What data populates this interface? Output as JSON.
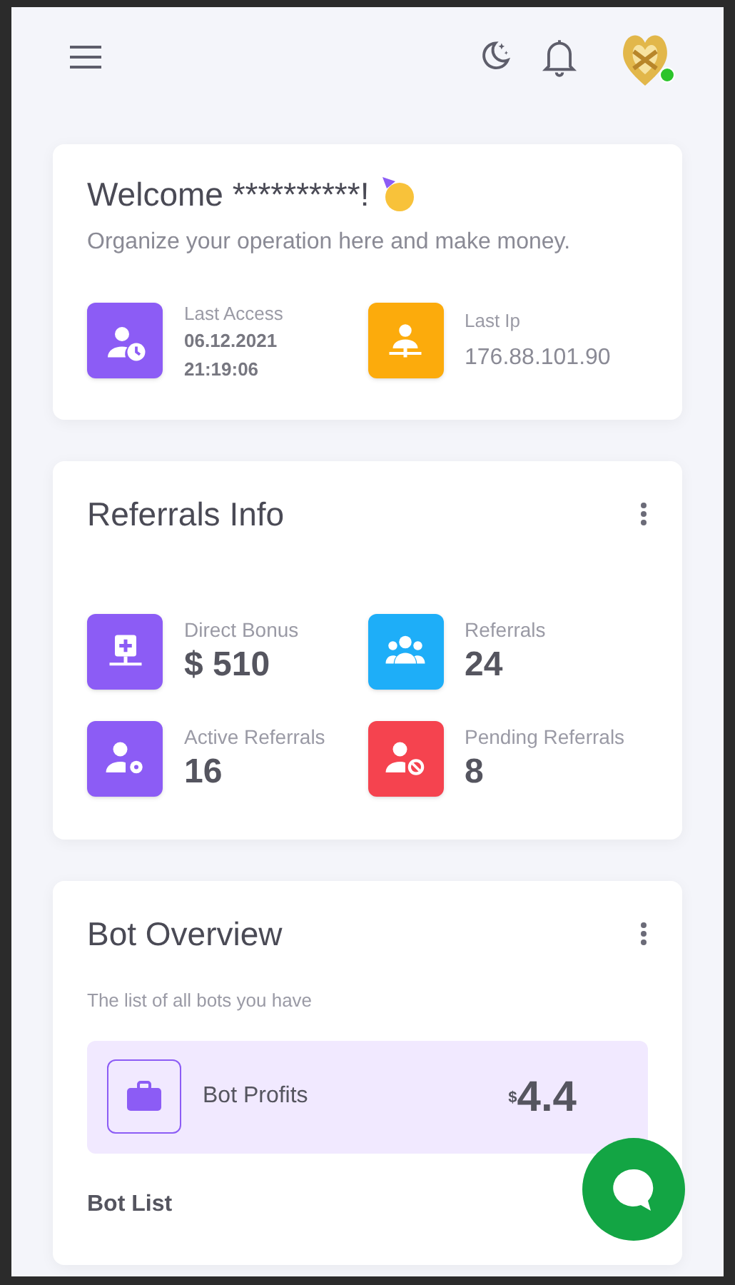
{
  "welcome": {
    "title": "Welcome **********!",
    "subtitle": "Organize your operation here and make money.",
    "stats": [
      {
        "kind": "access",
        "label": "Last Access",
        "lines": [
          "06.12.2021",
          "21:19:06"
        ],
        "color": "#8c5cf5"
      },
      {
        "kind": "ip",
        "label": "Last Ip",
        "lines": [
          "176.88.101.90"
        ],
        "color": "#fcab0c"
      }
    ]
  },
  "referrals": {
    "title": "Referrals Info",
    "stats": [
      {
        "kind": "bonus",
        "label": "Direct Bonus",
        "value": "$ 510",
        "color": "#8c5cf5"
      },
      {
        "kind": "group",
        "label": "Referrals",
        "value": "24",
        "color": "#1eaef8"
      },
      {
        "kind": "active",
        "label": "Active Referrals",
        "value": "16",
        "color": "#8c5cf5"
      },
      {
        "kind": "pending",
        "label": "Pending Referrals",
        "value": "8",
        "color": "#f5434f"
      }
    ]
  },
  "bots": {
    "title": "Bot Overview",
    "subtitle": "The list of all bots you have",
    "profit_label": "Bot Profits",
    "profit_currency": "$",
    "profit_value": "4.4",
    "list_title": "Bot List"
  }
}
